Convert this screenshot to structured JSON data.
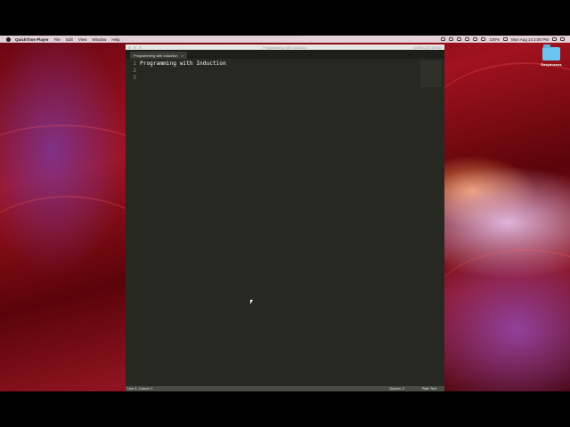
{
  "menubar": {
    "app_name": "QuickTime Player",
    "items": [
      "File",
      "Edit",
      "View",
      "Window",
      "Help"
    ],
    "battery": "100%",
    "clock": "Mon Aug 14  2:00 PM"
  },
  "desktop": {
    "folder_label": "Easybosses"
  },
  "window": {
    "title": "Programming with Induction",
    "unregistered": "UNREGISTERED",
    "tab_label": "Programming with Induction",
    "tab_close": "×",
    "line_numbers": [
      "1",
      "2",
      "3"
    ],
    "lines": [
      "Programming with Induction",
      "",
      ""
    ]
  },
  "statusbar": {
    "position": "Line 3, Column 1",
    "spaces": "Spaces: 2",
    "syntax": "Plain Text"
  }
}
